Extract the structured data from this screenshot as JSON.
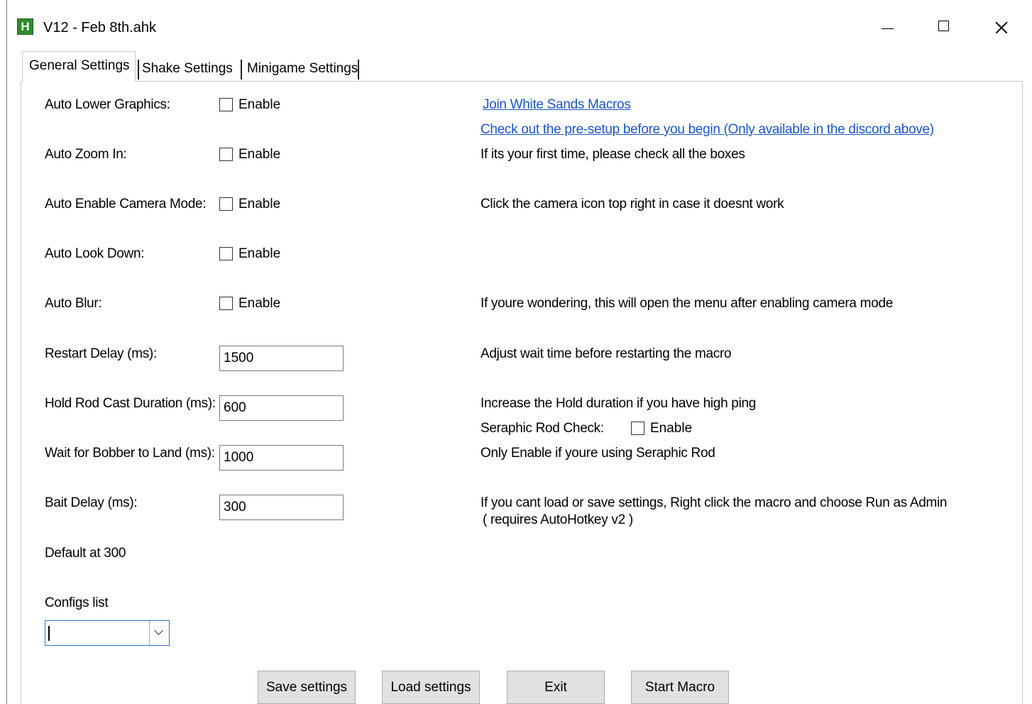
{
  "window": {
    "title": "V12 - Feb 8th.ahk",
    "icon_glyph": "H"
  },
  "tabs": [
    {
      "label": "General Settings",
      "active": true
    },
    {
      "label": "Shake Settings",
      "active": false
    },
    {
      "label": "Minigame Settings",
      "active": false
    }
  ],
  "settings": {
    "auto_lower_graphics": {
      "label": "Auto Lower Graphics:",
      "checkbox": "Enable",
      "checked": false
    },
    "auto_zoom_in": {
      "label": "Auto Zoom In:",
      "checkbox": "Enable",
      "checked": false
    },
    "auto_camera_mode": {
      "label": "Auto Enable Camera Mode:",
      "checkbox": "Enable",
      "checked": false
    },
    "auto_look_down": {
      "label": "Auto Look Down:",
      "checkbox": "Enable",
      "checked": false
    },
    "auto_blur": {
      "label": "Auto Blur:",
      "checkbox": "Enable",
      "checked": false
    },
    "restart_delay": {
      "label": "Restart Delay (ms):",
      "value": "1500"
    },
    "hold_rod_cast": {
      "label": "Hold Rod Cast Duration (ms):",
      "value": "600"
    },
    "wait_bobber": {
      "label": "Wait for Bobber to Land (ms):",
      "value": "1000"
    },
    "bait_delay": {
      "label": "Bait Delay (ms):",
      "value": "300"
    },
    "default_note": "Default at 300",
    "configs_label": "Configs list",
    "configs_value": ""
  },
  "info": {
    "join_link": "Join White Sands Macros",
    "presetup_link": "Check out the pre-setup before you begin (Only available in the discord above)",
    "first_time": "If its your first time, please check all the boxes",
    "camera_note": "Click the camera icon top right in case it doesnt work",
    "blur_note": "If youre wondering, this will open the menu after enabling camera mode",
    "restart_note": "Adjust wait time before restarting the macro",
    "ping_note": "Increase the Hold duration if you have high ping",
    "seraphic_label": "Seraphic Rod Check:",
    "seraphic_checkbox": "Enable",
    "seraphic_checked": false,
    "seraphic_note": "Only Enable if youre using Seraphic Rod",
    "admin_note_line1": "If you cant load or save settings, Right click the macro and choose Run as Admin",
    "admin_note_line2": "( requires AutoHotkey v2 )"
  },
  "buttons": {
    "save": "Save settings",
    "load": "Load settings",
    "exit": "Exit",
    "start": "Start Macro"
  },
  "colors": {
    "link": "#1a55c9",
    "icon_bg": "#2e8b2e",
    "focus_border": "#2d6fd1"
  }
}
